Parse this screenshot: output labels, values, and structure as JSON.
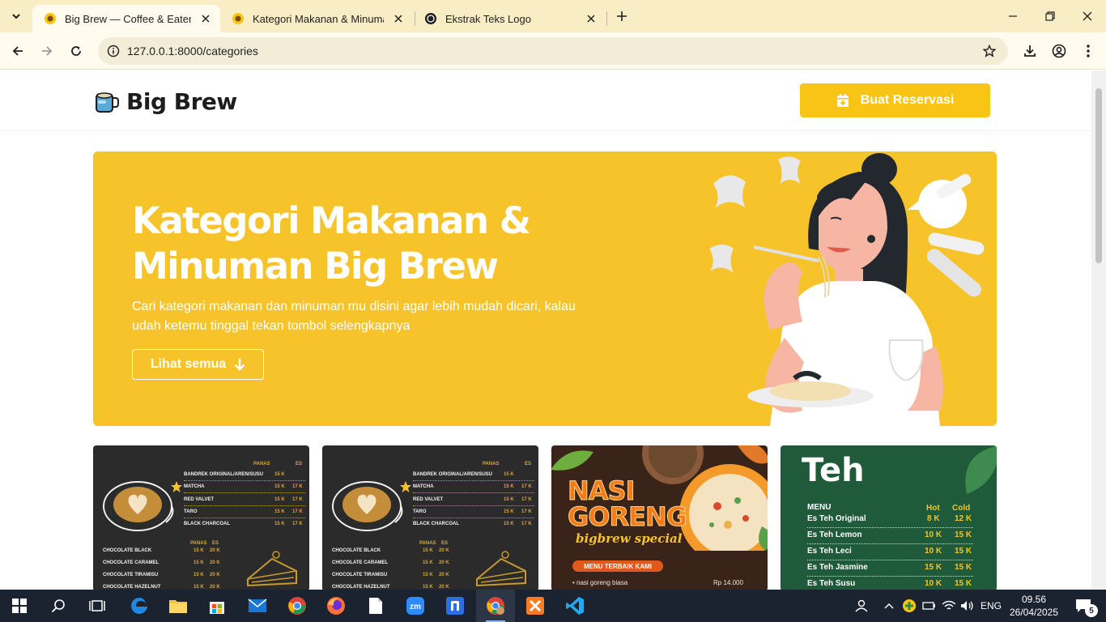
{
  "browser": {
    "tabs": [
      {
        "title": "Big Brew — Coffee & Eatery | R",
        "active": true
      },
      {
        "title": "Kategori Makanan & Minuman",
        "active": false
      },
      {
        "title": "Ekstrak Teks Logo",
        "active": false
      }
    ],
    "url": "127.0.0.1:8000/categories"
  },
  "site": {
    "brand": "Big Brew",
    "reserve_label": "Buat Reservasi"
  },
  "hero": {
    "title_line1": "Kategori Makanan &",
    "title_line2": "Minuman Big Brew",
    "subtitle": "Cari kategori makanan dan minuman mu disini agar lebih mudah dicari, kalau udah ketemu tinggal tekan tombol selengkapnya",
    "button_label": "Lihat semua"
  },
  "cards": {
    "coffee_menu": {
      "col_hot": "PANAS",
      "col_ice": "ES",
      "items": [
        {
          "name": "BANDREK ORIGINAL/AREN/SUSU",
          "hot": "15 K",
          "ice": ""
        },
        {
          "name": "MATCHA",
          "hot": "15 K",
          "ice": "17 K"
        },
        {
          "name": "RED VALVET",
          "hot": "15 K",
          "ice": "17 K"
        },
        {
          "name": "TARO",
          "hot": "15 K",
          "ice": "17 K"
        },
        {
          "name": "BLACK CHARCOAL",
          "hot": "15 K",
          "ice": "17 K"
        }
      ],
      "items2": [
        {
          "name": "CHOCOLATE BLACK",
          "hot": "15 K",
          "ice": "20 K"
        },
        {
          "name": "CHOCOLATE CARAMEL",
          "hot": "15 K",
          "ice": "20 K"
        },
        {
          "name": "CHOCOLATE TIRAMISU",
          "hot": "15 K",
          "ice": "20 K"
        },
        {
          "name": "CHOCOLATE HAZELNUT",
          "hot": "15 K",
          "ice": "20 K"
        }
      ]
    },
    "nasi": {
      "title_line1": "NASI",
      "title_line2": "GORENG",
      "special": "bigbrew special",
      "ribbon": "MENU TERBAIK KAMI",
      "item": "• nasi goreng biasa",
      "price": "Rp 14.000"
    },
    "teh": {
      "title": "Teh",
      "menu_label": "MENU",
      "col_hot": "Hot",
      "col_cold": "Cold",
      "items": [
        {
          "name": "Es Teh Original",
          "hot": "8 K",
          "cold": "12 K"
        },
        {
          "name": "Es Teh Lemon",
          "hot": "10 K",
          "cold": "15 K"
        },
        {
          "name": "Es Teh Leci",
          "hot": "10 K",
          "cold": "15 K"
        },
        {
          "name": "Es Teh Jasmine",
          "hot": "15 K",
          "cold": "15 K"
        },
        {
          "name": "Es Teh Susu",
          "hot": "10 K",
          "cold": "15 K"
        }
      ]
    }
  },
  "taskbar": {
    "lang": "ENG",
    "time": "09.56",
    "date": "26/04/2025",
    "notifications": "5"
  },
  "colors": {
    "accent": "#f8c415",
    "hero_bg": "#f6c42a",
    "tabstrip": "#f8edc4",
    "taskbar": "#1b2331"
  }
}
